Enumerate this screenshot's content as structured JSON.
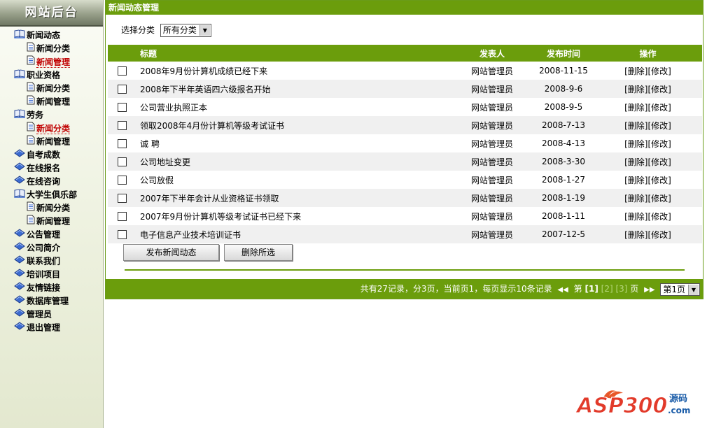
{
  "sidebar": {
    "title": "网站后台",
    "items": [
      {
        "label": "新闻动态",
        "level": 0,
        "icon": "open-book-icon",
        "active": false
      },
      {
        "label": "新闻分类",
        "level": 1,
        "icon": "document-icon",
        "active": false
      },
      {
        "label": "新闻管理",
        "level": 1,
        "icon": "document-icon",
        "active": true
      },
      {
        "label": "职业资格",
        "level": 0,
        "icon": "open-book-icon",
        "active": false
      },
      {
        "label": "新闻分类",
        "level": 1,
        "icon": "document-icon",
        "active": false
      },
      {
        "label": "新闻管理",
        "level": 1,
        "icon": "document-icon",
        "active": false
      },
      {
        "label": "劳务",
        "level": 0,
        "icon": "open-book-icon",
        "active": false
      },
      {
        "label": "新闻分类",
        "level": 1,
        "icon": "document-icon",
        "active": true
      },
      {
        "label": "新闻管理",
        "level": 1,
        "icon": "document-icon",
        "active": false
      },
      {
        "label": "自考成数",
        "level": 0,
        "icon": "diamond-icon",
        "active": false
      },
      {
        "label": "在线报名",
        "level": 0,
        "icon": "diamond-icon",
        "active": false
      },
      {
        "label": "在线咨询",
        "level": 0,
        "icon": "diamond-icon",
        "active": false
      },
      {
        "label": "大学生俱乐部",
        "level": 0,
        "icon": "open-book-icon",
        "active": false
      },
      {
        "label": "新闻分类",
        "level": 1,
        "icon": "document-icon",
        "active": false
      },
      {
        "label": "新闻管理",
        "level": 1,
        "icon": "document-icon",
        "active": false
      },
      {
        "label": "公告管理",
        "level": 0,
        "icon": "diamond-icon",
        "active": false
      },
      {
        "label": "公司简介",
        "level": 0,
        "icon": "diamond-icon",
        "active": false
      },
      {
        "label": "联系我们",
        "level": 0,
        "icon": "diamond-icon",
        "active": false
      },
      {
        "label": "培训项目",
        "level": 0,
        "icon": "diamond-icon",
        "active": false
      },
      {
        "label": "友情链接",
        "level": 0,
        "icon": "diamond-icon",
        "active": false
      },
      {
        "label": "数据库管理",
        "level": 0,
        "icon": "diamond-icon",
        "active": false
      },
      {
        "label": "管理员",
        "level": 0,
        "icon": "diamond-icon",
        "active": false
      },
      {
        "label": "退出管理",
        "level": 0,
        "icon": "diamond-icon",
        "active": false
      }
    ]
  },
  "panel": {
    "title": "新闻动态管理",
    "filter": {
      "label": "选择分类",
      "selected": "所有分类"
    },
    "columns": {
      "title": "标题",
      "author": "发表人",
      "date": "发布时间",
      "ops": "操作"
    },
    "rows": [
      {
        "title": "2008年9月份计算机成绩已经下来",
        "author": "网站管理员",
        "date": "2008-11-15",
        "ops": "[删除][修改]"
      },
      {
        "title": "2008年下半年英语四六级报名开始",
        "author": "网站管理员",
        "date": "2008-9-6",
        "ops": "[删除][修改]"
      },
      {
        "title": "公司营业执照正本",
        "author": "网站管理员",
        "date": "2008-9-5",
        "ops": "[删除][修改]"
      },
      {
        "title": "领取2008年4月份计算机等级考试证书",
        "author": "网站管理员",
        "date": "2008-7-13",
        "ops": "[删除][修改]"
      },
      {
        "title": "诚 聘",
        "author": "网站管理员",
        "date": "2008-4-13",
        "ops": "[删除][修改]"
      },
      {
        "title": "公司地址变更",
        "author": "网站管理员",
        "date": "2008-3-30",
        "ops": "[删除][修改]"
      },
      {
        "title": "公司放假",
        "author": "网站管理员",
        "date": "2008-1-27",
        "ops": "[删除][修改]"
      },
      {
        "title": "2007年下半年会计从业资格证书领取",
        "author": "网站管理员",
        "date": "2008-1-19",
        "ops": "[删除][修改]"
      },
      {
        "title": "2007年9月份计算机等级考试证书已经下来",
        "author": "网站管理员",
        "date": "2008-1-11",
        "ops": "[删除][修改]"
      },
      {
        "title": "电子信息产业技术培训证书",
        "author": "网站管理员",
        "date": "2007-12-5",
        "ops": "[删除][修改]"
      }
    ],
    "buttons": {
      "publish": "发布新闻动态",
      "delete_selected": "删除所选"
    },
    "pager": {
      "summary": "共有27记录，分3页，当前页1，每页显示10条记录",
      "prefix": "第",
      "current": "[1]",
      "page2": "[2]",
      "page3": "[3]",
      "suffix": "页",
      "jump": "第1页"
    }
  },
  "watermark": {
    "brand": "ASP300",
    "suffix": "源码",
    "domain": ".com"
  },
  "colors": {
    "accent": "#6b9d0c",
    "active_nav": "#c00000",
    "row_alt": "#f0f0f0"
  }
}
